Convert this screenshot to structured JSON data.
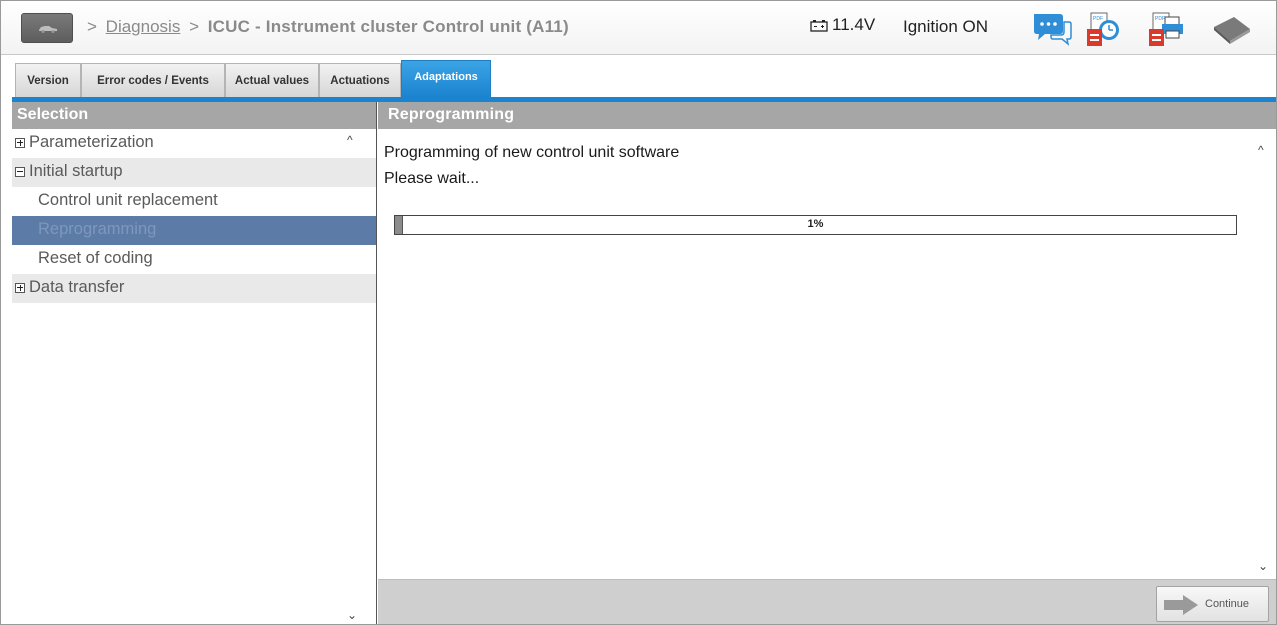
{
  "header": {
    "breadcrumb_sep1": ">",
    "breadcrumb_link": "Diagnosis",
    "breadcrumb_sep2": ">",
    "breadcrumb_current": "ICUC - Instrument cluster Control unit (A11)",
    "voltage": "11.4V",
    "ignition": "Ignition ON",
    "icons": [
      "car-home-icon",
      "battery-icon",
      "chat-icon",
      "pdf-time-icon",
      "pdf-print-icon",
      "book-icon"
    ]
  },
  "tabs": [
    {
      "label": "Version",
      "active": false
    },
    {
      "label": "Error codes / Events",
      "active": false
    },
    {
      "label": "Actual values",
      "active": false
    },
    {
      "label": "Actuations",
      "active": false
    },
    {
      "label": "Adaptations",
      "active": true
    }
  ],
  "selection": {
    "title": "Selection",
    "items": [
      {
        "label": "Parameterization",
        "type": "group",
        "expanded": false
      },
      {
        "label": "Initial startup",
        "type": "group",
        "expanded": true
      },
      {
        "label": "Control unit replacement",
        "type": "child"
      },
      {
        "label": "Reprogramming",
        "type": "child",
        "selected": true
      },
      {
        "label": "Reset of coding",
        "type": "child"
      },
      {
        "label": "Data transfer",
        "type": "group",
        "expanded": false
      }
    ]
  },
  "main": {
    "title": "Reprogramming",
    "line1": "Programming of new control unit software",
    "line2": "Please wait...",
    "progress_percent": 1,
    "progress_label": "1%",
    "continue_label": "Continue"
  },
  "colors": {
    "accent": "#1c83cf",
    "header_bar": "#a6a6a6",
    "selected_row": "#5c7ba6"
  }
}
